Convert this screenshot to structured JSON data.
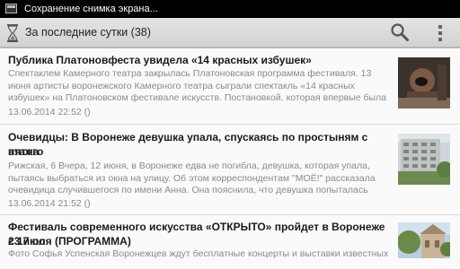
{
  "status_bar": {
    "notification_text": "Сохранение снимка экрана...",
    "icon": "screenshot-icon"
  },
  "action_bar": {
    "title": "За последние сутки (38)",
    "app_icon": "hourglass-icon",
    "actions": [
      "search-icon",
      "overflow-menu-icon"
    ]
  },
  "news": [
    {
      "title": "Публика Платоновфеста увидела «14 красных избушек»",
      "description_lines": [
        "Спектаклем Камерного театра закрылась Платоновская программа фестиваля. 13",
        "июня артисты воронежского Камерного театра сыграли спектакль «14 красных",
        "избушек» на Платоновском фестивале искусств. Постановкой, которая впервые была"
      ],
      "date": "13.06.2014 22:52 ()",
      "thumbnail": "stage-photo"
    },
    {
      "title_lines": [
        "Очевидцы: В Воронеже девушка упала, спускаясь по простыням с пятого",
        "этажа"
      ],
      "description_lines": [
        "Рижская, 6 Вчера, 12 июня, в Воронеже едва не погибла, девушка, которая упала,",
        "пытаясь выбраться из окна на улицу. Об этом корреспондентам \"МОЁ!\" рассказала",
        "очевидица случившегося по имени Анна. Она пояснила, что девушка попыталась"
      ],
      "date": "13.06.2014 21:52 ()",
      "thumbnail": "apartment-building-photo"
    },
    {
      "title_lines": [
        "Фестиваль современного искусства «ОТКРЫТО» пройдет в Воронеже с 17 по",
        "23 июля (ПРОГРАММА)"
      ],
      "description_lines": [
        "Фото Софья Успенская Воронежцев ждут бесплатные концерты и выставки известных"
      ],
      "thumbnail": "park-pavilion-photo"
    }
  ]
}
